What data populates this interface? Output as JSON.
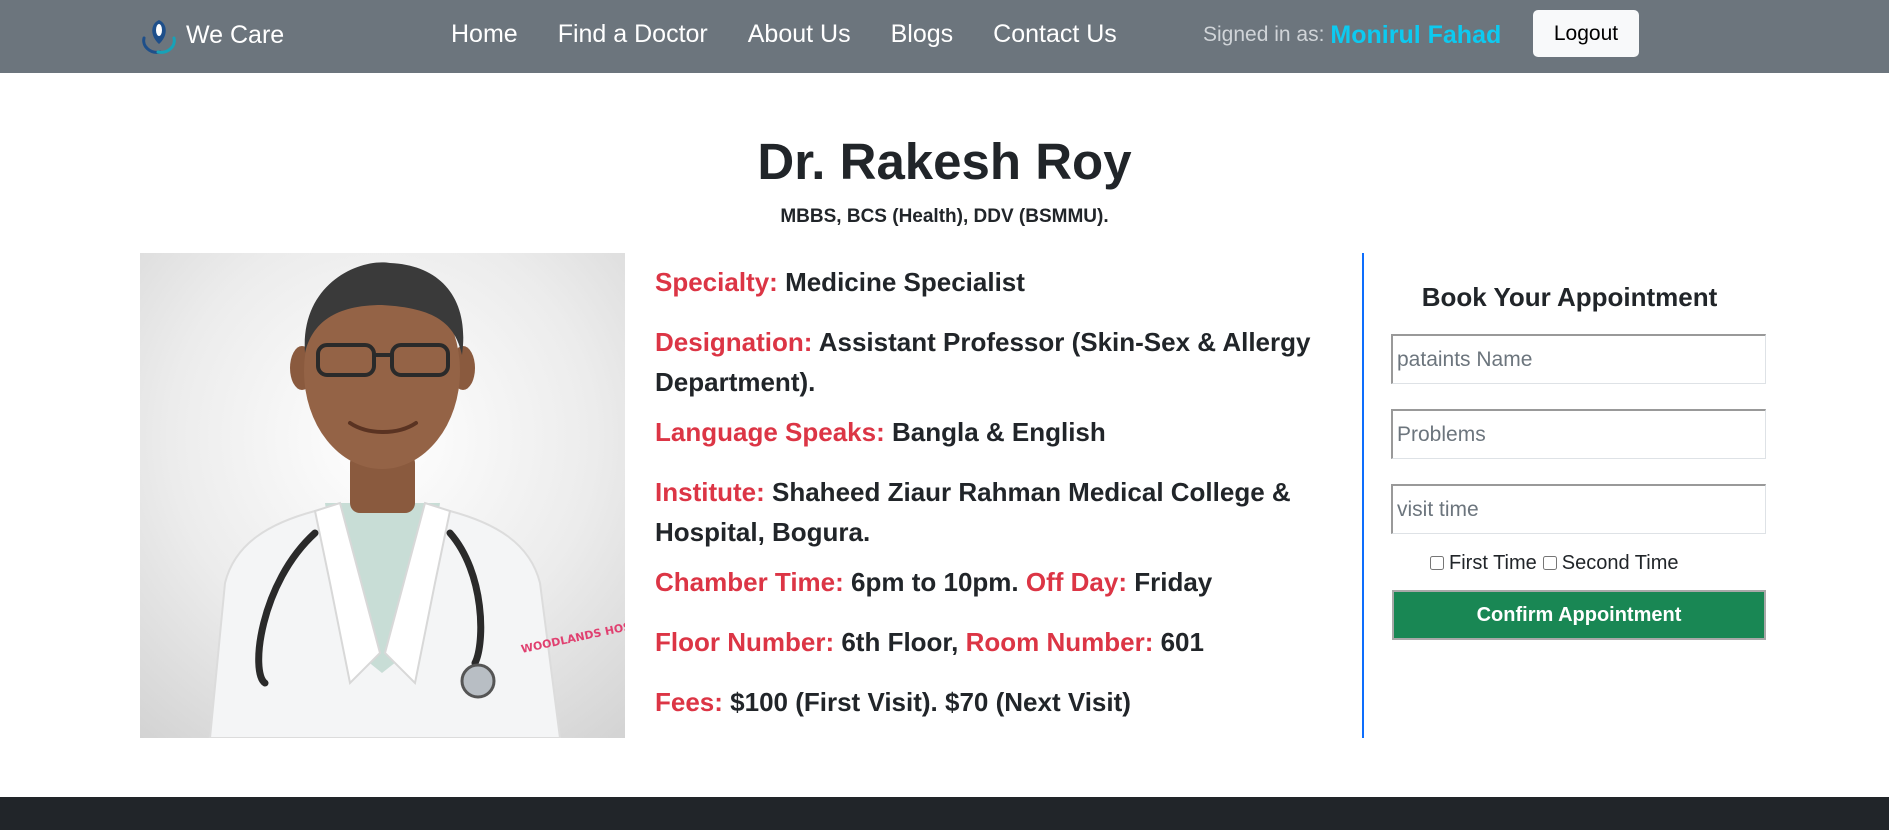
{
  "navbar": {
    "brand": {
      "icon": "heart-hands-logo-icon",
      "text": "We Care"
    },
    "links": [
      "Home",
      "Find a Doctor",
      "About Us",
      "Blogs",
      "Contact Us"
    ],
    "signed_in_label": "Signed in as:",
    "user_name": "Monirul Fahad",
    "logout_label": "Logout"
  },
  "doctor": {
    "name": "Dr. Rakesh Roy",
    "degrees": "MBBS, BCS (Health), DDV (BSMMU).",
    "photo": {
      "icon": "doctor-portrait",
      "coat_badge": "WOODLANDS HOSPITAL"
    },
    "specialty_label": "Specialty:",
    "specialty": "Medicine Specialist",
    "designation_label": "Designation:",
    "designation_line1": "Assistant Professor (Skin-Sex & Allergy",
    "designation_line2": "Department).",
    "language_label": "Language Speaks:",
    "language": "Bangla & English",
    "institute_label": "Institute:",
    "institute_line1": "Shaheed Ziaur Rahman Medical College &",
    "institute_line2": "Hospital, Bogura.",
    "chamber_label": "Chamber Time:",
    "chamber_time": "6pm to 10pm.",
    "offday_label": "Off Day:",
    "offday": "Friday",
    "floor_label": "Floor Number:",
    "floor": "6th Floor,",
    "room_label": "Room Number:",
    "room": "601",
    "fees_label": "Fees:",
    "fees": "$100 (First Visit). $70 (Next Visit)"
  },
  "appointment": {
    "title": "Book Your Appointment",
    "name_placeholder": "pataints Name",
    "problems_placeholder": "Problems",
    "time_placeholder": "visit time",
    "first_time_label": "First Time",
    "second_time_label": "Second Time",
    "confirm_label": "Confirm Appointment"
  },
  "colors": {
    "navbar_bg": "#6c757d",
    "user_name": "#0dcaf0",
    "label_red": "#dc3545",
    "divider_blue": "#0d6efd",
    "confirm_green": "#198754",
    "footer_bg": "#212529"
  }
}
